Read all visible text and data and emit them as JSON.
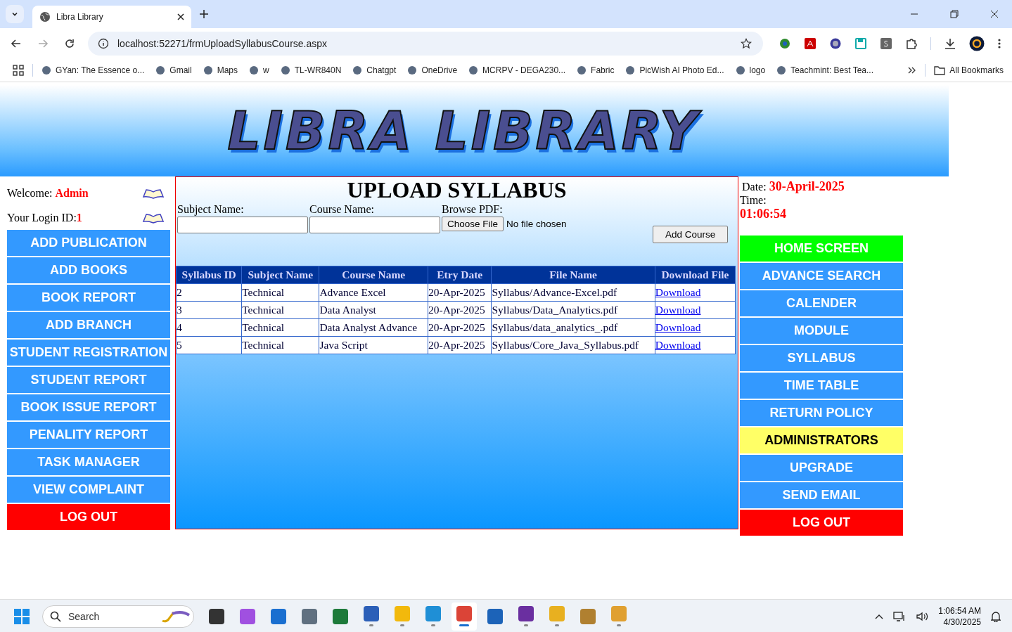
{
  "browser": {
    "tab": {
      "title": "Libra Library"
    },
    "url": "localhost:52271/frmUploadSyllabusCourse.aspx",
    "bookmarks": [
      "GYan: The Essence o...",
      "Gmail",
      "Maps",
      "w",
      "TL-WR840N",
      "Chatgpt",
      "OneDrive",
      "MCRPV - DEGA230...",
      "Fabric",
      "PicWish AI Photo Ed...",
      "logo",
      "Teachmint: Best Tea..."
    ],
    "all_bookmarks": "All Bookmarks"
  },
  "banner": {
    "logo": "LIBRA LIBRARY"
  },
  "user": {
    "welcome_label": "Welcome:",
    "welcome_name": "Admin",
    "login_label": "Your Login ID:",
    "login_id": "1"
  },
  "left_menu": [
    {
      "label": "ADD PUBLICATION",
      "color": "#3399ff"
    },
    {
      "label": "ADD BOOKS",
      "color": "#3399ff"
    },
    {
      "label": "BOOK REPORT",
      "color": "#3399ff"
    },
    {
      "label": "ADD BRANCH",
      "color": "#3399ff"
    },
    {
      "label": "STUDENT REGISTRATION",
      "color": "#3399ff"
    },
    {
      "label": "STUDENT REPORT",
      "color": "#3399ff"
    },
    {
      "label": "BOOK ISSUE REPORT",
      "color": "#3399ff"
    },
    {
      "label": "PENALITY REPORT",
      "color": "#3399ff"
    },
    {
      "label": "TASK MANAGER",
      "color": "#3399ff"
    },
    {
      "label": "VIEW COMPLAINT",
      "color": "#3399ff"
    },
    {
      "label": "LOG OUT",
      "color": "#ff0000"
    }
  ],
  "form": {
    "title": "UPLOAD SYLLABUS",
    "subject_label": "Subject Name:",
    "course_label": "Course Name:",
    "pdf_label": "Browse PDF:",
    "choose_button": "Choose File",
    "file_status": "No file chosen",
    "submit_button": "Add Course"
  },
  "table": {
    "columns": [
      "Syllabus ID",
      "Subject Name",
      "Course Name",
      "Etry Date",
      "File Name",
      "Download File"
    ],
    "rows": [
      [
        "2",
        "Technical",
        "Advance Excel",
        "20-Apr-2025",
        "Syllabus/Advance-Excel.pdf",
        "Download"
      ],
      [
        "3",
        "Technical",
        "Data Analyst",
        "20-Apr-2025",
        "Syllabus/Data_Analytics.pdf",
        "Download"
      ],
      [
        "4",
        "Technical",
        "Data Analyst Advance",
        "20-Apr-2025",
        "Syllabus/data_analytics_.pdf",
        "Download"
      ],
      [
        "5",
        "Technical",
        "Java Script",
        "20-Apr-2025",
        "Syllabus/Core_Java_Syllabus.pdf",
        "Download"
      ]
    ]
  },
  "clock": {
    "date_label": "Date:",
    "date": "30-April-2025",
    "time_label": "Time:",
    "time": "01:06:54"
  },
  "right_menu": [
    {
      "label": "HOME SCREEN",
      "color": "#00ff00"
    },
    {
      "label": "ADVANCE SEARCH",
      "color": "#3399ff"
    },
    {
      "label": "CALENDER",
      "color": "#3399ff"
    },
    {
      "label": "MODULE",
      "color": "#3399ff"
    },
    {
      "label": "SYLLABUS",
      "color": "#3399ff"
    },
    {
      "label": "TIME TABLE",
      "color": "#3399ff"
    },
    {
      "label": "RETURN POLICY",
      "color": "#3399ff"
    },
    {
      "label": "ADMINISTRATORS",
      "color": "#ffff66"
    },
    {
      "label": "UPGRADE",
      "color": "#3399ff"
    },
    {
      "label": "SEND EMAIL",
      "color": "#3399ff"
    },
    {
      "label": "LOG OUT",
      "color": "#ff0000"
    }
  ],
  "taskbar": {
    "search_placeholder": "Search",
    "time": "1:06:54 AM",
    "date": "4/30/2025",
    "apps": [
      {
        "running": false,
        "active": false
      },
      {
        "running": false,
        "active": false
      },
      {
        "running": false,
        "active": false
      },
      {
        "running": false,
        "active": false
      },
      {
        "running": false,
        "active": false
      },
      {
        "running": true,
        "active": false
      },
      {
        "running": true,
        "active": false
      },
      {
        "running": true,
        "active": false
      },
      {
        "running": true,
        "active": true
      },
      {
        "running": false,
        "active": false
      },
      {
        "running": true,
        "active": false
      },
      {
        "running": true,
        "active": false
      },
      {
        "running": false,
        "active": false
      },
      {
        "running": true,
        "active": false
      }
    ]
  }
}
